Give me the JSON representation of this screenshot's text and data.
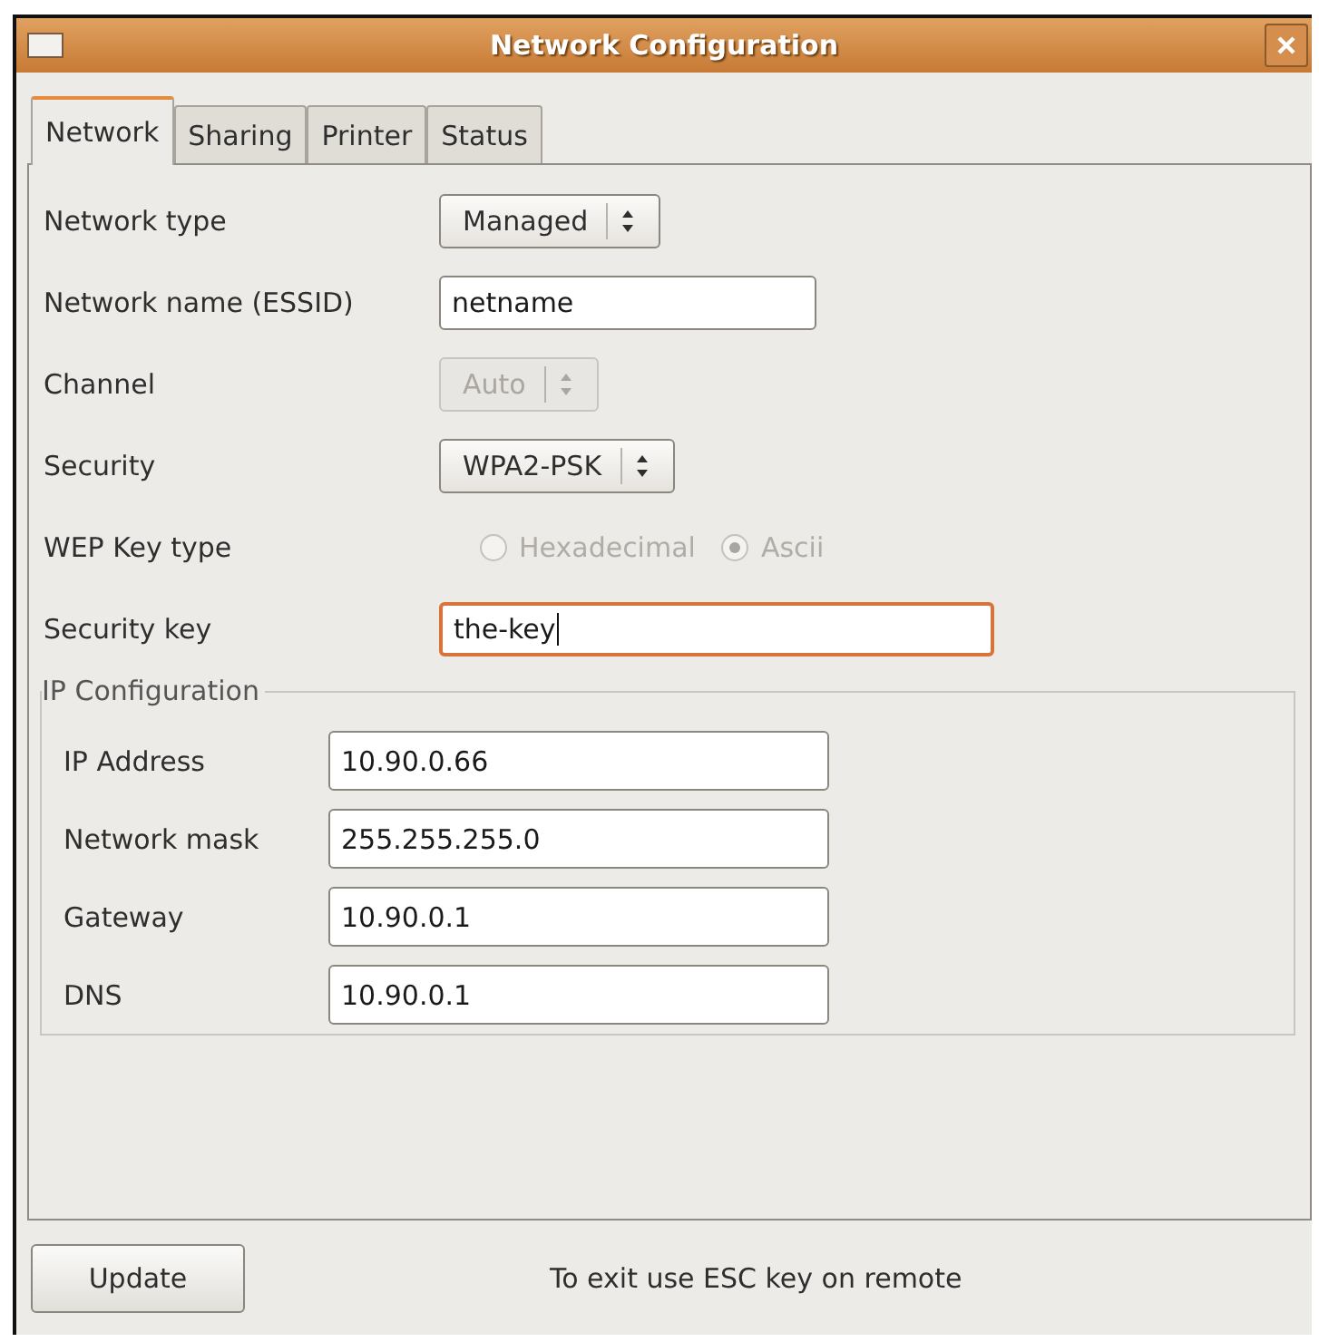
{
  "window": {
    "title": "Network Configuration"
  },
  "tabs": [
    {
      "label": "Network",
      "selected": true
    },
    {
      "label": "Sharing",
      "selected": false
    },
    {
      "label": "Printer",
      "selected": false
    },
    {
      "label": "Status",
      "selected": false
    }
  ],
  "fields": [
    {
      "kind": "select",
      "label": "Network type",
      "value": "Managed",
      "disabled": false
    },
    {
      "kind": "text",
      "label": "Network name (ESSID)",
      "value": "netname",
      "focused": false
    },
    {
      "kind": "select",
      "label": "Channel",
      "value": "Auto",
      "disabled": true
    },
    {
      "kind": "select",
      "label": "Security",
      "value": "WPA2-PSK",
      "disabled": false
    },
    {
      "kind": "radio",
      "label": "WEP Key type",
      "disabled": true,
      "options": [
        {
          "label": "Hexadecimal",
          "selected": false
        },
        {
          "label": "Ascii",
          "selected": true
        }
      ]
    },
    {
      "kind": "text",
      "label": "Security key",
      "value": "the-key",
      "focused": true
    }
  ],
  "ip_configuration": {
    "title": "IP Configuration",
    "fields": [
      {
        "label": "IP Address",
        "value": "10.90.0.66"
      },
      {
        "label": "Network mask",
        "value": "255.255.255.0"
      },
      {
        "label": "Gateway",
        "value": "10.90.0.1"
      },
      {
        "label": "DNS",
        "value": "10.90.0.1"
      }
    ]
  },
  "footer": {
    "button": "Update",
    "hint": "To exit use ESC key on remote"
  }
}
